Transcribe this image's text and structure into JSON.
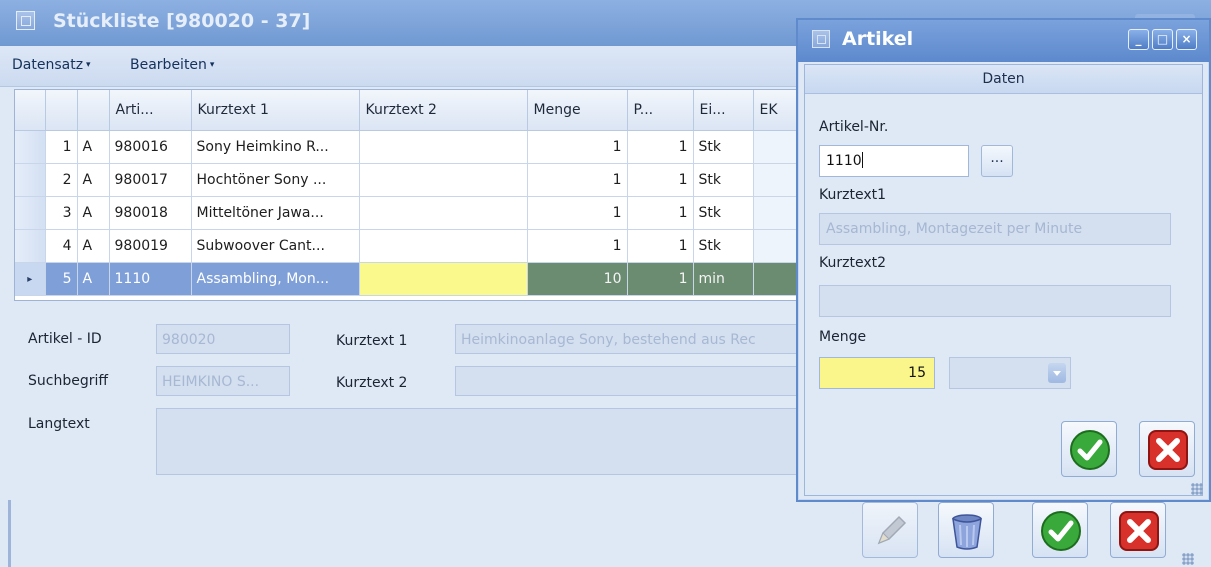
{
  "main": {
    "title": "Stückliste [980020 - 37]",
    "menu": [
      {
        "label": "Datensatz",
        "arrow": "▾"
      },
      {
        "label": "Bearbeiten",
        "arrow": "▾"
      }
    ],
    "grid": {
      "columns": [
        "",
        "Arti...",
        "Kurztext 1",
        "Kurztext 2",
        "Menge",
        "P...",
        "Ei...",
        "EK"
      ],
      "rows": [
        {
          "no": "1",
          "type": "A",
          "artikel": "980016",
          "k1": "Sony Heimkino R...",
          "k2": "",
          "menge": "1",
          "p": "1",
          "einheit": "Stk"
        },
        {
          "no": "2",
          "type": "A",
          "artikel": "980017",
          "k1": "Hochtöner Sony ...",
          "k2": "",
          "menge": "1",
          "p": "1",
          "einheit": "Stk"
        },
        {
          "no": "3",
          "type": "A",
          "artikel": "980018",
          "k1": "Mitteltöner Jawa...",
          "k2": "",
          "menge": "1",
          "p": "1",
          "einheit": "Stk"
        },
        {
          "no": "4",
          "type": "A",
          "artikel": "980019",
          "k1": "Subwoover Cant...",
          "k2": "",
          "menge": "1",
          "p": "1",
          "einheit": "Stk"
        },
        {
          "no": "5",
          "type": "A",
          "artikel": "1110",
          "k1": "Assambling, Mon...",
          "k2": "",
          "menge": "10",
          "p": "1",
          "einheit": "min",
          "selected": true
        }
      ],
      "row_indicator": "▸"
    },
    "details": {
      "artikel_id_label": "Artikel - ID",
      "artikel_id_value": "980020",
      "suchbegriff_label": "Suchbegriff",
      "suchbegriff_value": "HEIMKINO S...",
      "kurztext1_label": "Kurztext 1",
      "kurztext1_value": "Heimkinoanlage Sony, bestehend aus Rec",
      "kurztext2_label": "Kurztext 2",
      "kurztext2_value": "",
      "langtext_label": "Langtext"
    },
    "actions": [
      "edit-icon",
      "delete-icon",
      "confirm-icon",
      "cancel-icon"
    ]
  },
  "dialog": {
    "title": "Artikel",
    "window_buttons": {
      "minimize": "_",
      "maximize": "□",
      "close": "×"
    },
    "tab": "Daten",
    "artikel_nr_label": "Artikel-Nr.",
    "artikel_nr_value": "1110",
    "lookup_button": "...",
    "kurztext1_label": "Kurztext1",
    "kurztext1_value": "Assambling, Montagezeit per Minute",
    "kurztext2_label": "Kurztext2",
    "kurztext2_value": "",
    "menge_label": "Menge",
    "menge_value": "15",
    "unit_value": ""
  },
  "colors": {
    "title_bar": "#7099d2",
    "selected_row": "#7f9fd8",
    "highlight_yellow": "#fbf68c",
    "confirm_green": "#39a83a",
    "cancel_red": "#d8302a"
  }
}
